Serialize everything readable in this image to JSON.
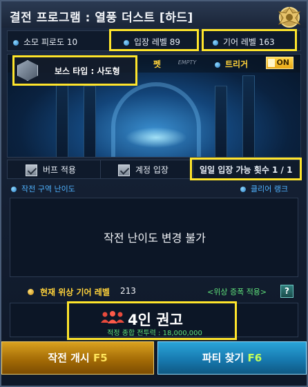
{
  "window": {
    "title": "결전 프로그램 : 열풍 더스트 [하드]"
  },
  "stats": {
    "fatigue": "소모 피로도 10",
    "entry_level": "입장 레벨 89",
    "gear_level": "기어 레벨 163"
  },
  "scene": {
    "boss_type": "보스 타입 : 사도형",
    "pet_label": "펫",
    "pet_slot": "EMPTY",
    "trigger_label": "트리거",
    "trigger_toggle": "ON"
  },
  "options": {
    "buff": "버프 적용",
    "account_entry": "계정 입장",
    "daily_entry": "일일 입장 가능 횟수 1 / 1"
  },
  "difficulty": {
    "section_label": "작전 구역 난이도",
    "clear_rank": "클리어 랭크",
    "message": "작전 난이도 변경 불가"
  },
  "gear": {
    "label": "현재 위상 기어 레벨",
    "value": "213",
    "link": "<위상 증폭 적용>",
    "help": "?"
  },
  "party": {
    "title": "4인 권고",
    "subtitle": "적정 종합 전투력 : 18,000,000"
  },
  "buttons": {
    "start_label": "작전 개시",
    "start_key": "F5",
    "party_label": "파티 찾기",
    "party_key": "F6"
  },
  "colors": {
    "highlight": "#ffe52b",
    "gold": "#ffd23a",
    "green": "#5fe07a",
    "accent_blue": "#4fb3ff"
  }
}
